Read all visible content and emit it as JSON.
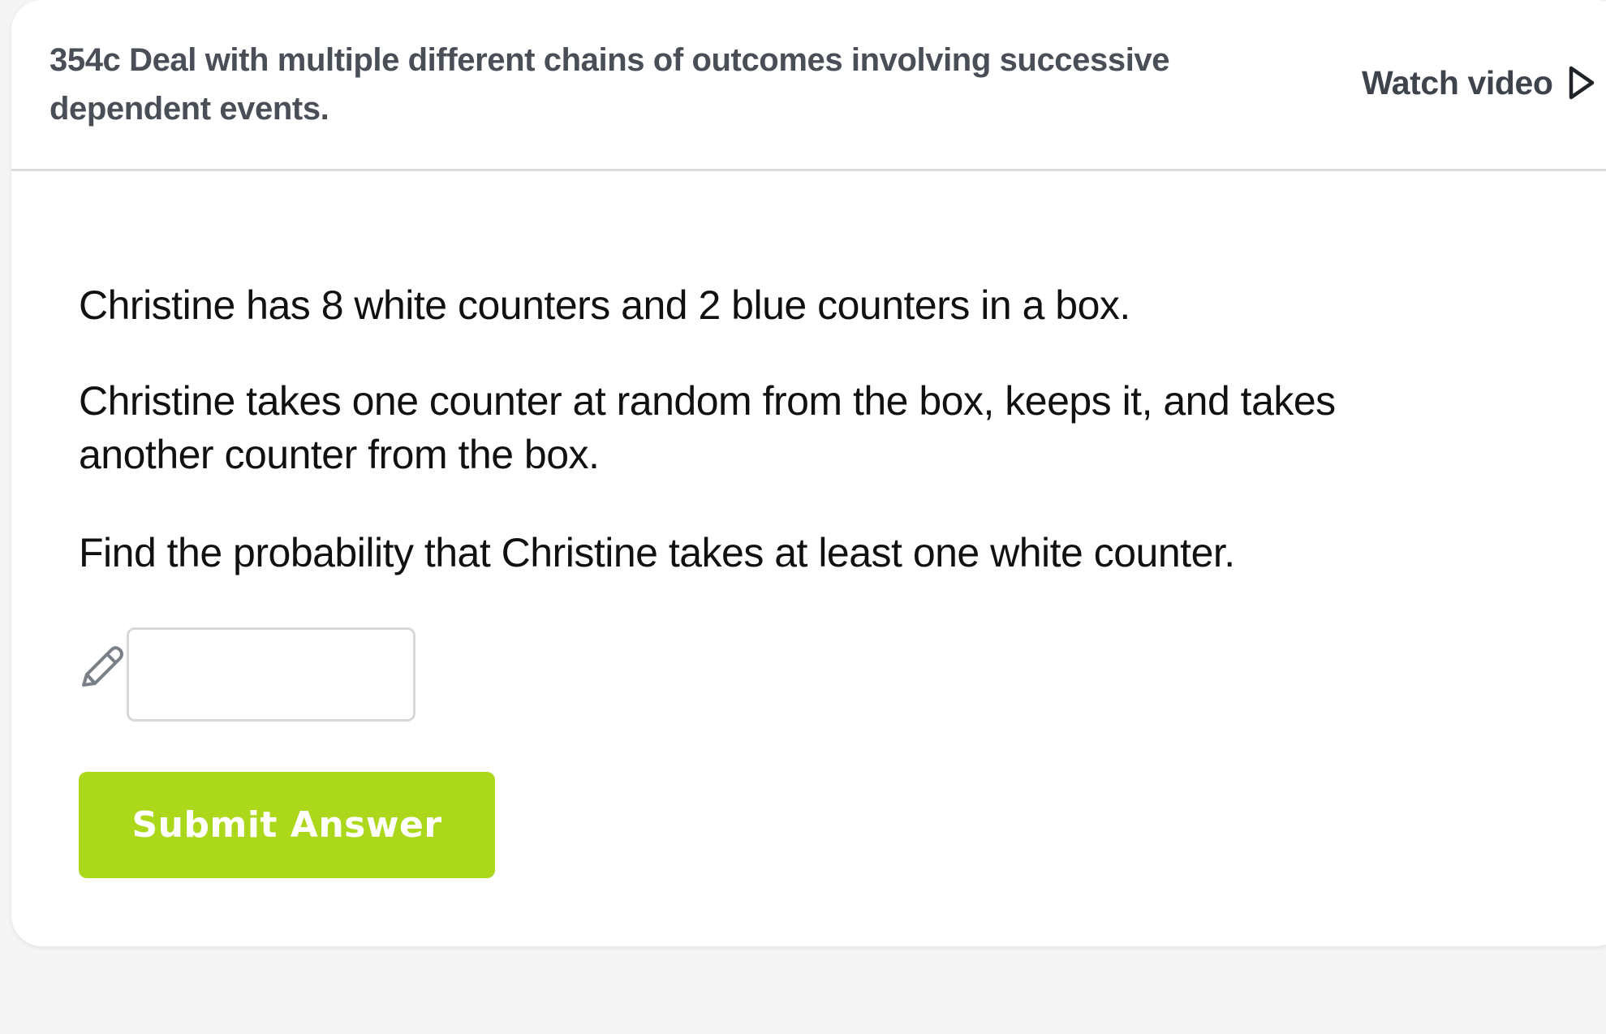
{
  "header": {
    "skill_title": "354c Deal with multiple different chains of outcomes involving successive dependent events.",
    "watch_video_label": "Watch video",
    "watch_video_icon": "play-triangle-outline-icon"
  },
  "question": {
    "paragraphs": [
      "Christine has 8 white counters and 2 blue counters in a box.",
      "Christine takes one counter at random from the box, keeps it, and takes another counter from the box.",
      "Find the probability that Christine takes at least one white counter."
    ]
  },
  "answer": {
    "input_value": "",
    "input_placeholder": "",
    "pencil_icon": "pencil-icon"
  },
  "actions": {
    "submit_label": "Submit Answer"
  },
  "colors": {
    "submit_button": "#acd81c",
    "title_text": "#4a4f57",
    "page_background": "#f5f5f5",
    "card_background": "#ffffff"
  }
}
